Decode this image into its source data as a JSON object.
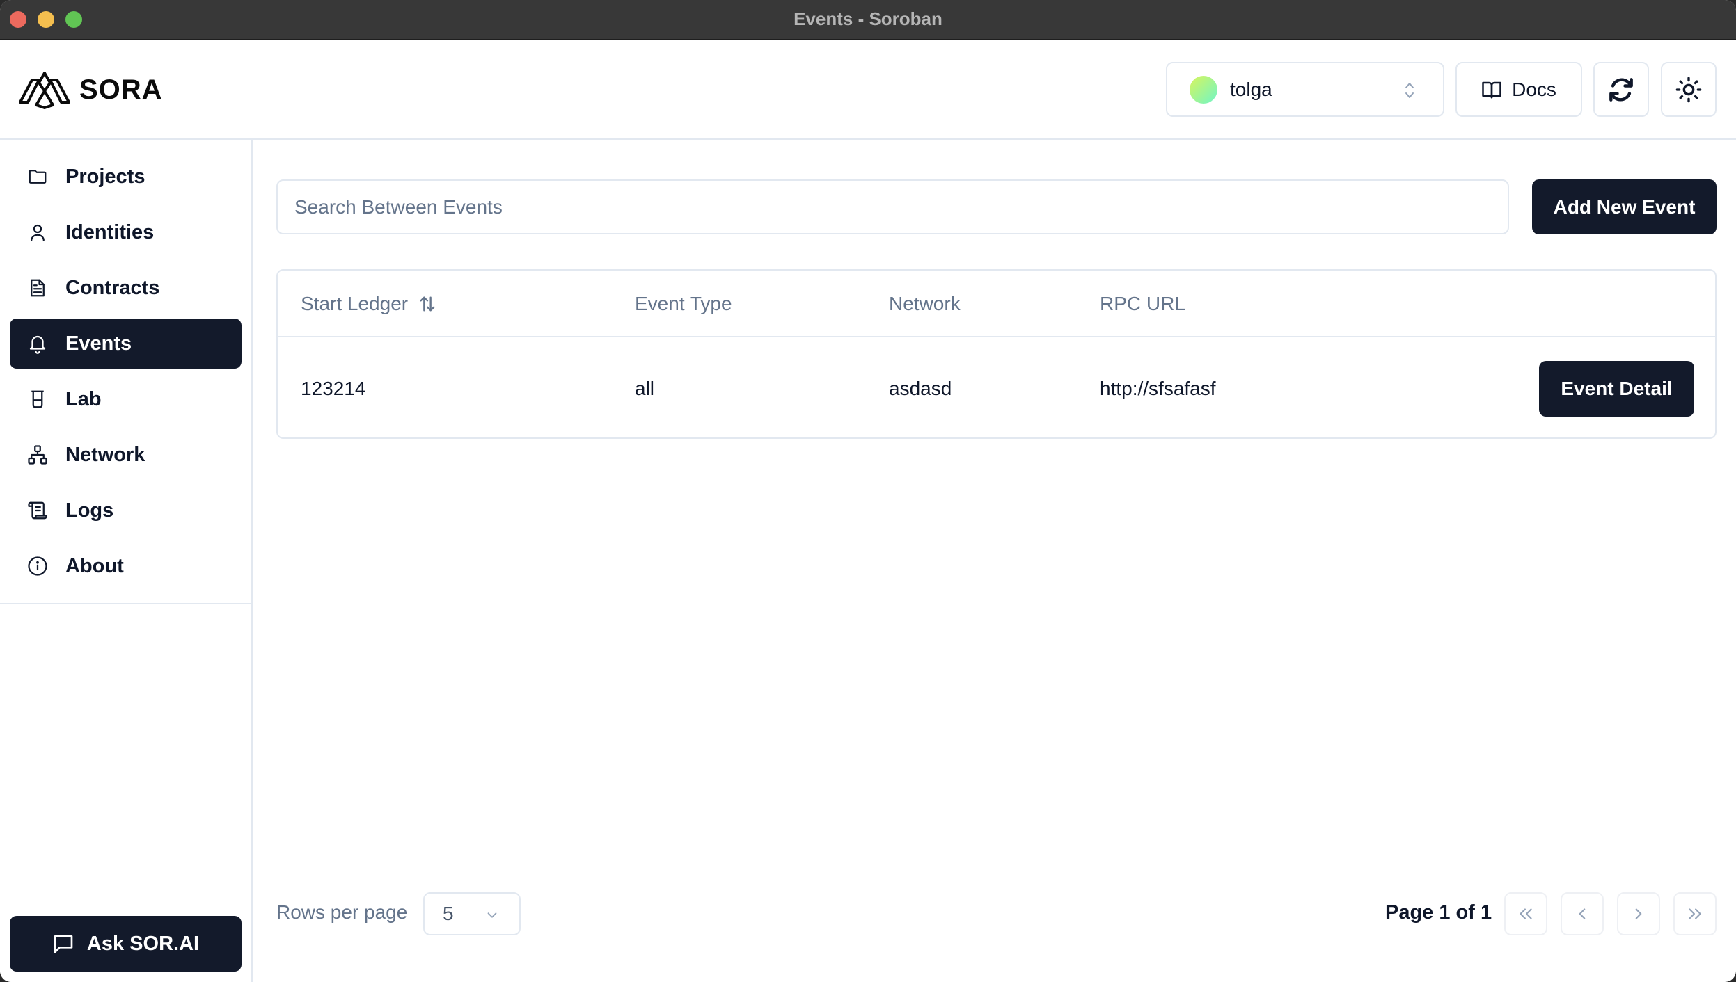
{
  "window": {
    "title": "Events - Soroban"
  },
  "header": {
    "logo_text": "SORA",
    "identity": {
      "name": "tolga",
      "avatar_gradient": [
        "#d9f55b",
        "#6ff5c8"
      ]
    },
    "docs_label": "Docs",
    "icons": {
      "docs": "book-open-icon",
      "refresh": "refresh-icon",
      "theme": "sun-icon",
      "identity_selector": "chevrons-up-down-icon"
    }
  },
  "sidebar": {
    "items": [
      {
        "label": "Projects",
        "icon": "folder-icon",
        "active": false
      },
      {
        "label": "Identities",
        "icon": "user-icon",
        "active": false
      },
      {
        "label": "Contracts",
        "icon": "file-text-icon",
        "active": false
      },
      {
        "label": "Events",
        "icon": "bell-icon",
        "active": true
      },
      {
        "label": "Lab",
        "icon": "beaker-icon",
        "active": false
      },
      {
        "label": "Network",
        "icon": "network-icon",
        "active": false
      },
      {
        "label": "Logs",
        "icon": "scroll-icon",
        "active": false
      },
      {
        "label": "About",
        "icon": "info-icon",
        "active": false
      }
    ],
    "ask_button_label": "Ask SOR.AI"
  },
  "main": {
    "search": {
      "placeholder": "Search Between Events",
      "value": ""
    },
    "add_button_label": "Add New Event",
    "table": {
      "columns": [
        "Start Ledger",
        "Event Type",
        "Network",
        "RPC URL"
      ],
      "rows": [
        {
          "start_ledger": "123214",
          "event_type": "all",
          "network": "asdasd",
          "rpc_url": "http://sfsafasf",
          "action_label": "Event Detail"
        }
      ]
    },
    "pagination": {
      "rows_per_page_label": "Rows per page",
      "rows_per_page_value": "5",
      "page_info": "Page 1 of 1"
    }
  },
  "colors": {
    "primary_dark": "#131a2b",
    "border": "#e2e8f0",
    "muted_text": "#64748b",
    "titlebar": "#383838"
  }
}
